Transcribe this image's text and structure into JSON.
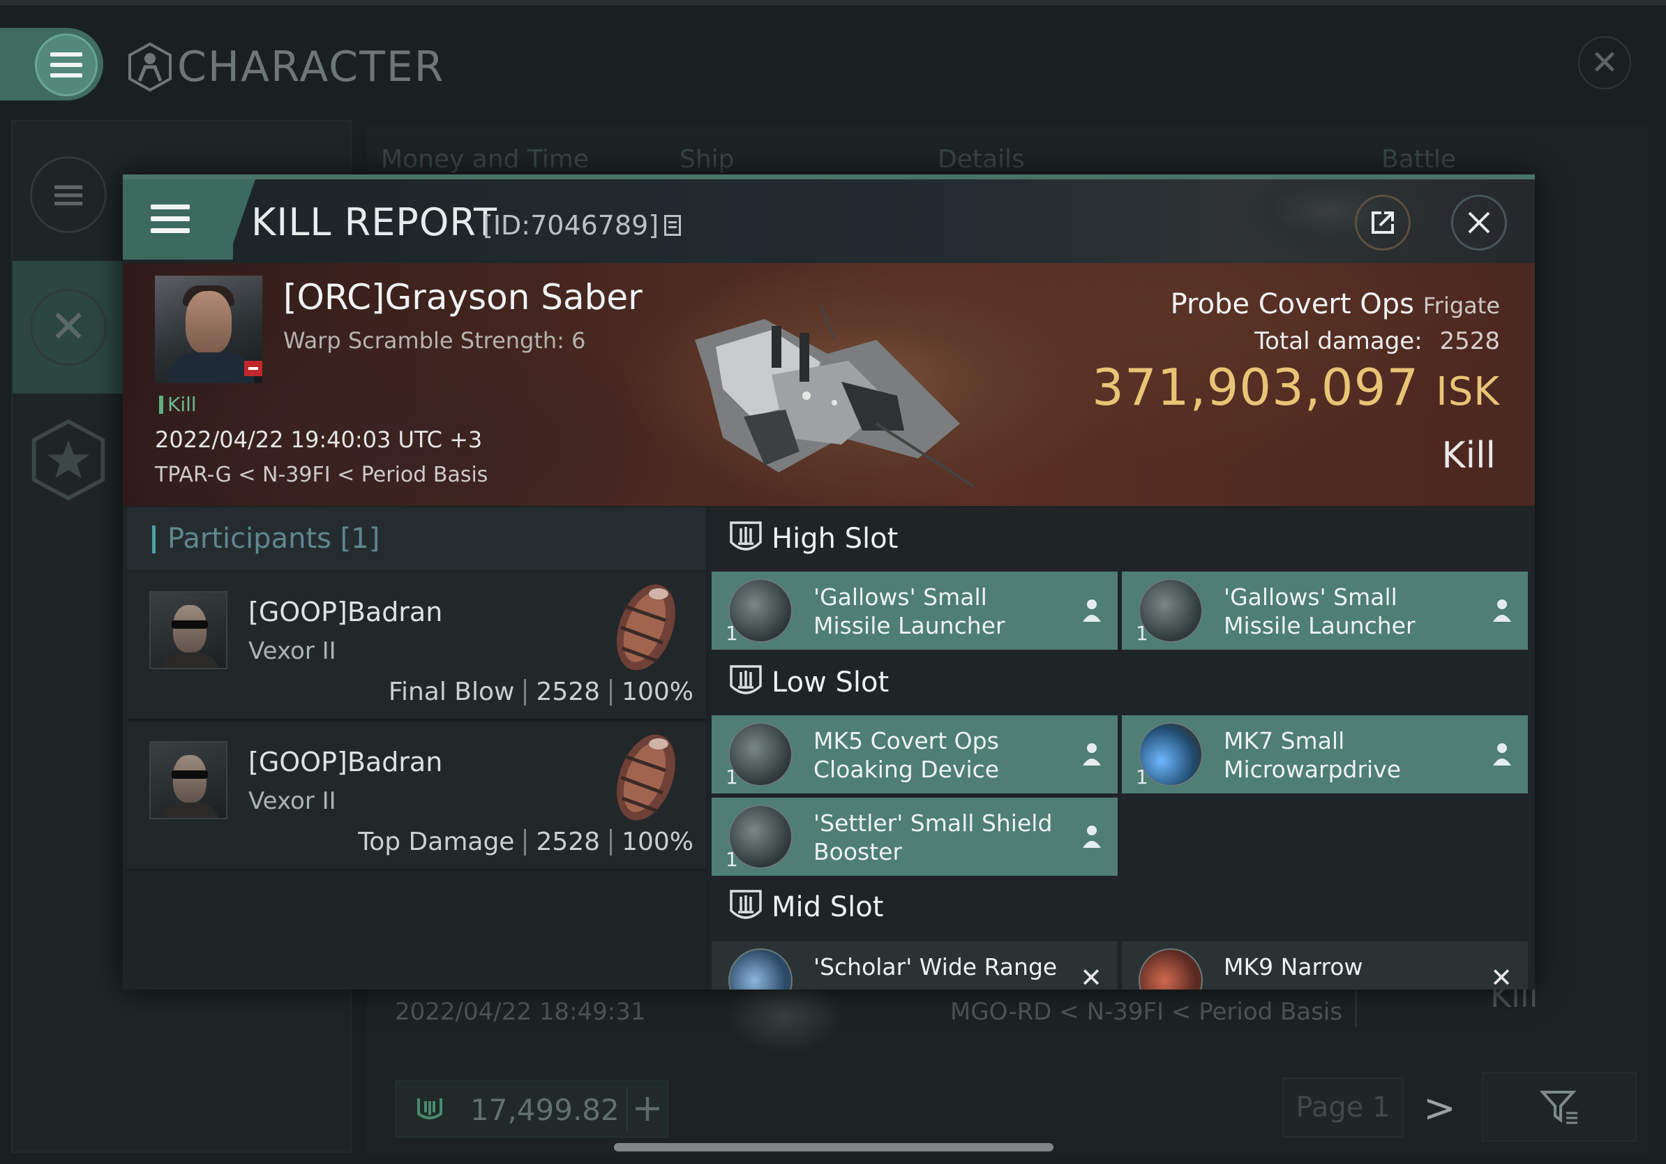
{
  "app": {
    "title": "CHARACTER"
  },
  "background": {
    "tabs": [
      "Money and Time",
      "Ship",
      "Details",
      "Battle Status"
    ],
    "row_date": "2022/04/22  18:49:31",
    "row_location": "MGO-RD < N-39FI < Period Basis",
    "row_result": "Kill",
    "wallet_balance": "17,499.82",
    "wallet_add": "+",
    "page_label": "Page 1",
    "next_label": ">"
  },
  "kill_report": {
    "title": "KILL REPORT",
    "id_label": "[ID:7046789]",
    "victim": {
      "name": "[ORC]Grayson Saber",
      "warp_scramble": "Warp Scramble Strength: 6",
      "tag": "Kill",
      "datetime": "2022/04/22 19:40:03 UTC +3",
      "location": "TPAR-G < N-39FI < Period Basis"
    },
    "ship": {
      "name": "Probe Covert Ops",
      "class": "Frigate",
      "total_damage_label": "Total damage:",
      "total_damage": "2528",
      "isk_value": "371,903,097",
      "isk_unit": "ISK",
      "result": "Kill"
    },
    "participants": {
      "title": "Participants [1]",
      "rows": [
        {
          "name": "[GOOP]Badran",
          "ship": "Vexor II",
          "role": "Final Blow",
          "damage": "2528",
          "percent": "100%"
        },
        {
          "name": "[GOOP]Badran",
          "ship": "Vexor II",
          "role": "Top Damage",
          "damage": "2528",
          "percent": "100%"
        }
      ]
    },
    "fitting": {
      "high_slot": {
        "title": "High Slot",
        "modules": [
          {
            "qty": "1",
            "name": "'Gallows' Small Missile Launcher",
            "icon": "missile-launcher-icon"
          },
          {
            "qty": "1",
            "name": "'Gallows' Small Missile Launcher",
            "icon": "missile-launcher-icon"
          }
        ]
      },
      "low_slot": {
        "title": "Low Slot",
        "modules": [
          {
            "qty": "1",
            "name": "MK5 Covert Ops Cloaking Device",
            "icon": "cloaking-device-icon"
          },
          {
            "qty": "1",
            "name": "MK7 Small Microwarpdrive",
            "icon": "microwarpdrive-icon"
          },
          {
            "qty": "1",
            "name": "'Settler' Small Shield Booster",
            "icon": "shield-booster-icon"
          }
        ]
      },
      "mid_slot": {
        "title": "Mid Slot",
        "modules": [
          {
            "name": "'Scholar' Wide Range",
            "icon": "scanner-icon"
          },
          {
            "name": "MK9 Narrow",
            "icon": "scanner-icon"
          }
        ]
      }
    },
    "colors": {
      "accent": "#4e7e74",
      "isk_gold": "#e8c476",
      "kill_green": "#6cbb8c"
    }
  }
}
